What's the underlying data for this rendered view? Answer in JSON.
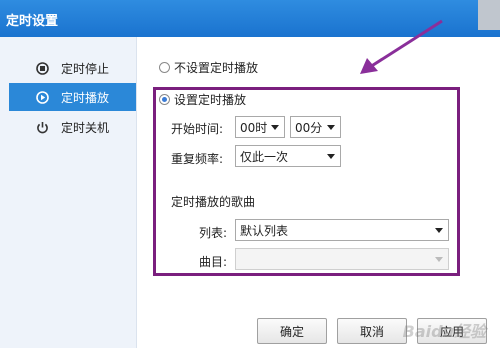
{
  "window": {
    "title": "定时设置"
  },
  "sidebar": {
    "items": [
      {
        "label": "定时停止",
        "icon": "stop-icon",
        "active": false
      },
      {
        "label": "定时播放",
        "icon": "play-icon",
        "active": true
      },
      {
        "label": "定时关机",
        "icon": "power-icon",
        "active": false
      }
    ]
  },
  "options": {
    "no_timer_label": "不设置定时播放",
    "set_timer_label": "设置定时播放",
    "selected": "设置定时播放"
  },
  "schedule": {
    "start_time_label": "开始时间:",
    "hour_value": "00时",
    "minute_value": "00分",
    "repeat_label": "重复频率:",
    "repeat_value": "仅此一次"
  },
  "songs": {
    "section_title": "定时播放的歌曲",
    "list_label": "列表:",
    "list_value": "默认列表",
    "track_label": "曲目:",
    "track_value": ""
  },
  "buttons": {
    "ok": "确定",
    "cancel": "取消",
    "apply": "应用"
  },
  "watermark": "Baidu经验",
  "colors": {
    "titlebar": "#1f7ad6",
    "active_item": "#2b88d8",
    "highlight_box": "#7a1f7e",
    "arrow": "#8a2f9a"
  }
}
